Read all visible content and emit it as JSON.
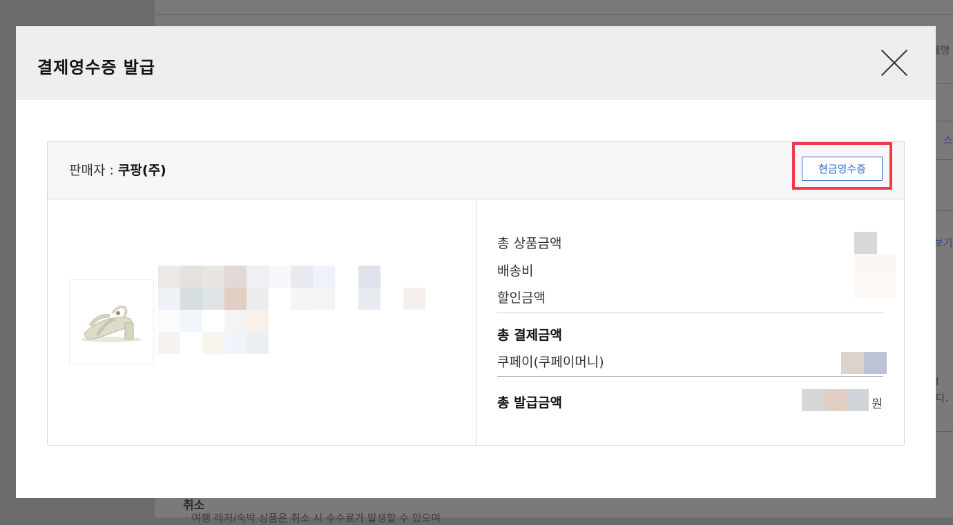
{
  "modal": {
    "title": "결제영수증 발급",
    "seller_prefix": "판매자 : ",
    "seller_name": "쿠팡(주)",
    "cash_receipt_button": "현금영수증"
  },
  "summary": {
    "total_product_amount_label": "총 상품금액",
    "shipping_label": "배송비",
    "discount_label": "할인금액",
    "total_payment_label": "총 결제금액",
    "payment_method_label": "쿠페이(쿠페이머니)",
    "total_issue_label": "총 발급금액",
    "currency_unit": "원"
  },
  "background_page": {
    "frag_top_right": "제명",
    "frag_link_1": "스",
    "frag_link_2": "보기",
    "frag_right_1": "I",
    "frag_right_2": "다.",
    "cancel_heading": "취소",
    "cancel_text": "· 여행 레저/숙박 상품은 취소 시 수수료가 발생할 수 있으며"
  },
  "colors": {
    "accent_blue": "#2f6fc4",
    "highlight_red": "#f03a47",
    "header_bg": "#eeeeee"
  }
}
